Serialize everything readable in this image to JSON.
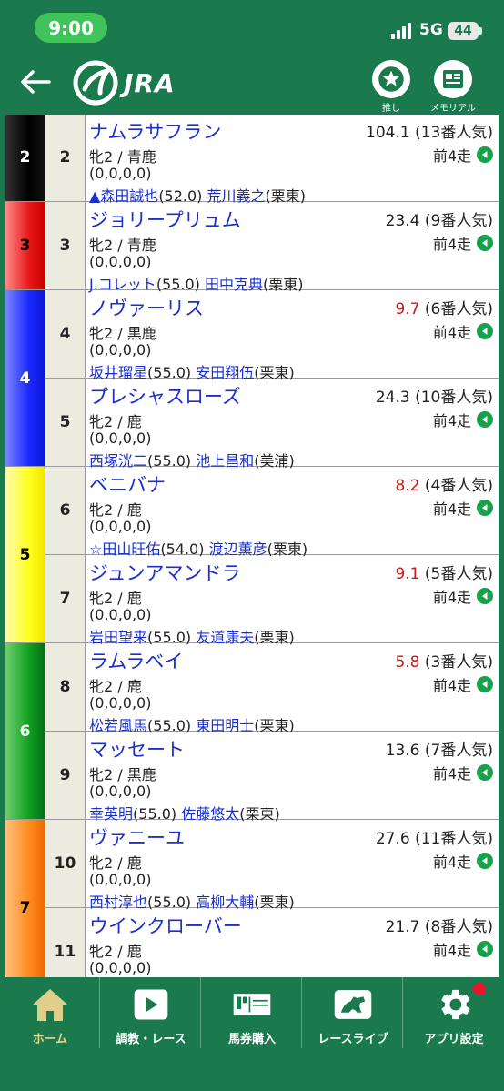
{
  "status_bar": {
    "time": "9:00",
    "network": "5G",
    "battery": "44"
  },
  "header": {
    "logo_text": "JRA",
    "fav_label": "推し",
    "memorial_label": "メモリアル"
  },
  "frames": [
    {
      "label": "2",
      "color": "#000000",
      "text_color": "#ffffff"
    },
    {
      "label": "3",
      "color": "#e81818",
      "text_color": "#000000"
    },
    {
      "label": "4",
      "color": "#1a28ff",
      "text_color": "#ffffff"
    },
    {
      "label": "5",
      "color": "#ffff1e",
      "text_color": "#000000"
    },
    {
      "label": "6",
      "color": "#10a020",
      "text_color": "#ffffff"
    },
    {
      "label": "7",
      "color": "#ff8c1e",
      "text_color": "#000000"
    }
  ],
  "horses": [
    {
      "num": "2",
      "name": "ナムラサフラン",
      "odds": "104.1",
      "pop": "(13番人気)",
      "odds_red": false,
      "sex_color": "牝2 / 青鹿",
      "record": "(0,0,0,0)",
      "jockey": "▲森田誠也",
      "weight": "(52.0)",
      "trainer": "荒川義之",
      "stable": "(栗東)",
      "prev": "前4走"
    },
    {
      "num": "3",
      "name": "ジョリープリュム",
      "odds": "23.4",
      "pop": "(9番人気)",
      "odds_red": false,
      "sex_color": "牝2 / 青鹿",
      "record": "(0,0,0,0)",
      "jockey": "J.コレット",
      "weight": "(55.0)",
      "trainer": "田中克典",
      "stable": "(栗東)",
      "prev": "前4走"
    },
    {
      "num": "4",
      "name": "ノヴァーリス",
      "odds": "9.7",
      "pop": "(6番人気)",
      "odds_red": true,
      "sex_color": "牝2 / 黒鹿",
      "record": "(0,0,0,0)",
      "jockey": "坂井瑠星",
      "weight": "(55.0)",
      "trainer": "安田翔伍",
      "stable": "(栗東)",
      "prev": "前4走"
    },
    {
      "num": "5",
      "name": "プレシャスローズ",
      "odds": "24.3",
      "pop": "(10番人気)",
      "odds_red": false,
      "sex_color": "牝2 / 鹿",
      "record": "(0,0,0,0)",
      "jockey": "西塚洸二",
      "weight": "(55.0)",
      "trainer": "池上昌和",
      "stable": "(美浦)",
      "prev": "前4走"
    },
    {
      "num": "6",
      "name": "ベニバナ",
      "odds": "8.2",
      "pop": "(4番人気)",
      "odds_red": true,
      "sex_color": "牝2 / 鹿",
      "record": "(0,0,0,0)",
      "jockey": "☆田山旺佑",
      "weight": "(54.0)",
      "trainer": "渡辺薫彦",
      "stable": "(栗東)",
      "prev": "前4走"
    },
    {
      "num": "7",
      "name": "ジュンアマンドラ",
      "odds": "9.1",
      "pop": "(5番人気)",
      "odds_red": true,
      "sex_color": "牝2 / 鹿",
      "record": "(0,0,0,0)",
      "jockey": "岩田望来",
      "weight": "(55.0)",
      "trainer": "友道康夫",
      "stable": "(栗東)",
      "prev": "前4走"
    },
    {
      "num": "8",
      "name": "ラムラベイ",
      "odds": "5.8",
      "pop": "(3番人気)",
      "odds_red": true,
      "sex_color": "牝2 / 鹿",
      "record": "(0,0,0,0)",
      "jockey": "松若風馬",
      "weight": "(55.0)",
      "trainer": "東田明士",
      "stable": "(栗東)",
      "prev": "前4走"
    },
    {
      "num": "9",
      "name": "マッセート",
      "odds": "13.6",
      "pop": "(7番人気)",
      "odds_red": false,
      "sex_color": "牝2 / 黒鹿",
      "record": "(0,0,0,0)",
      "jockey": "幸英明",
      "weight": "(55.0)",
      "trainer": "佐藤悠太",
      "stable": "(栗東)",
      "prev": "前4走"
    },
    {
      "num": "10",
      "name": "ヴァニーユ",
      "odds": "27.6",
      "pop": "(11番人気)",
      "odds_red": false,
      "sex_color": "牝2 / 鹿",
      "record": "(0,0,0,0)",
      "jockey": "西村淳也",
      "weight": "(55.0)",
      "trainer": "高柳大輔",
      "stable": "(栗東)",
      "prev": "前4走"
    },
    {
      "num": "11",
      "name": "ウインクローバー",
      "odds": "21.7",
      "pop": "(8番人気)",
      "odds_red": false,
      "sex_color": "牝2 / 鹿",
      "record": "(0,0,0,0)",
      "jockey": "",
      "weight": "",
      "trainer": "",
      "stable": "",
      "prev": "前4走"
    }
  ],
  "nav": [
    {
      "label": "ホーム",
      "icon": "home-icon",
      "active": true
    },
    {
      "label": "調教・レース",
      "icon": "play-icon",
      "active": false
    },
    {
      "label": "馬券購入",
      "icon": "ticket-icon",
      "active": false
    },
    {
      "label": "レースライブ",
      "icon": "horse-live-icon",
      "active": false
    },
    {
      "label": "アプリ設定",
      "icon": "gear-icon",
      "active": false,
      "badge": true
    }
  ]
}
